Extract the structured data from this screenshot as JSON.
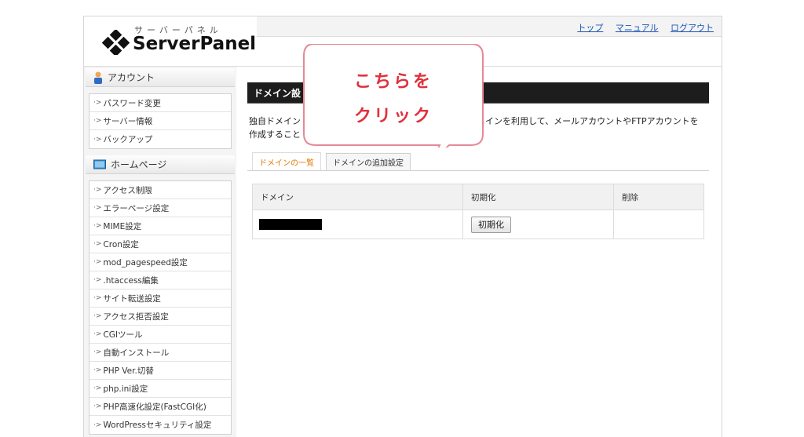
{
  "logo": {
    "sub": "サーバーパネル",
    "name": "ServerPanel"
  },
  "toplinks": [
    "トップ",
    "マニュアル",
    "ログアウト"
  ],
  "sidebar": {
    "account": {
      "heading": "アカウント",
      "items": [
        "パスワード変更",
        "サーバー情報",
        "バックアップ"
      ]
    },
    "homepage": {
      "heading": "ホームページ",
      "items": [
        "アクセス制限",
        "エラーページ設定",
        "MIME設定",
        "Cron設定",
        "mod_pagespeed設定",
        ".htaccess編集",
        "サイト転送設定",
        "アクセス拒否設定",
        "CGIツール",
        "自動インストール",
        "PHP Ver.切替",
        "php.ini設定",
        "PHP高速化設定(FastCGI化)",
        "WordPressセキュリティ設定"
      ]
    }
  },
  "main": {
    "title": "ドメイン設",
    "desc_line1_left": "独自ドメイン",
    "desc_line1_right": "メインを利用して、メールアカウントやFTPアカウントを",
    "desc_line2": "作成すること",
    "tabs": [
      "ドメインの一覧",
      "ドメインの追加設定"
    ],
    "table": {
      "headers": [
        "ドメイン",
        "初期化",
        "削除"
      ],
      "init_button": "初期化"
    }
  },
  "callout": {
    "line1": "こちらを",
    "line2": "クリック",
    "color": "#e0303c"
  }
}
